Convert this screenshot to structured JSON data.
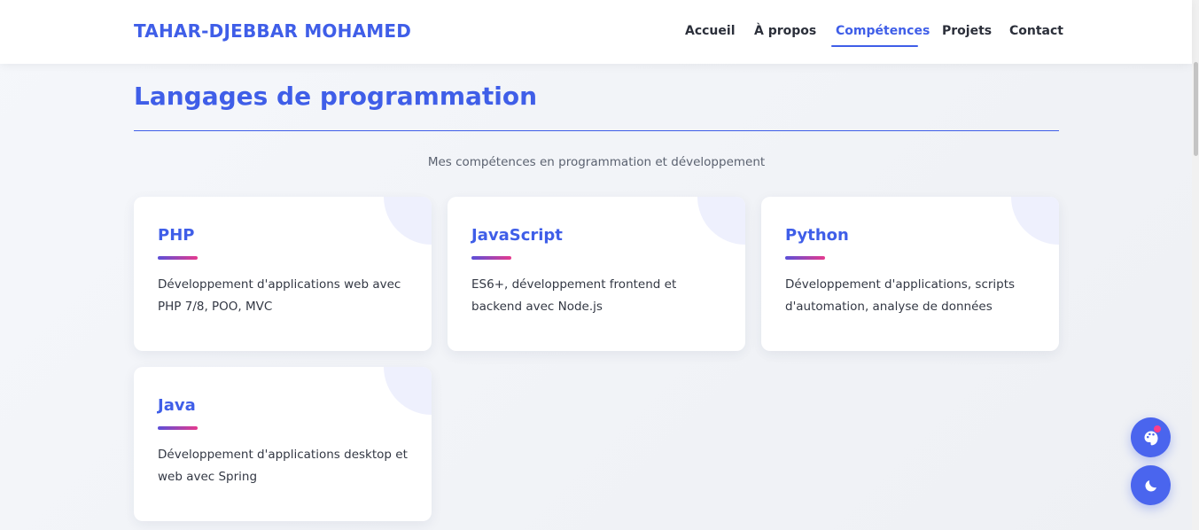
{
  "brand": "TAHAR-DJEBBAR MOHAMED",
  "nav": [
    {
      "label": "Accueil"
    },
    {
      "label": "À propos"
    },
    {
      "label": "Compétences"
    },
    {
      "label": "Projets"
    },
    {
      "label": "Contact"
    }
  ],
  "active_nav": "Compétences",
  "section": {
    "title": "Langages de programmation",
    "subtitle": "Mes compétences en programmation et développement"
  },
  "cards": [
    {
      "title": "PHP",
      "desc": "Développement d'applications web avec PHP 7/8, POO, MVC"
    },
    {
      "title": "JavaScript",
      "desc": "ES6+, développement frontend et backend avec Node.js"
    },
    {
      "title": "Python",
      "desc": "Développement d'applications, scripts d'automation, analyse de données"
    },
    {
      "title": "Java",
      "desc": "Développement d'applications desktop et web avec Spring"
    }
  ],
  "fabs": [
    {
      "icon": "palette-icon"
    },
    {
      "icon": "moon-icon"
    }
  ],
  "colors": {
    "accent": "#3f5ee8",
    "fab": "#4a65ee",
    "gradient_start": "#5b4fd8",
    "gradient_end": "#e63a8e",
    "notification_dot": "#ff3d8a"
  }
}
